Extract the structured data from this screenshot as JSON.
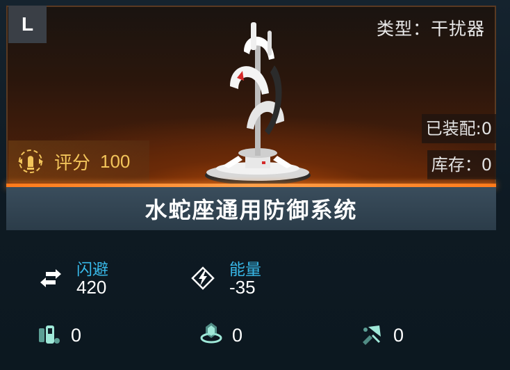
{
  "item": {
    "grade": "L",
    "type_label": "类型：干扰器",
    "equipped_label": "已装配:0",
    "stock_label": "库存：0",
    "score_label": "评分",
    "score_value": "100",
    "name": "水蛇座通用防御系统"
  },
  "stats": [
    {
      "label": "闪避",
      "value": "420",
      "icon": "dodge-arrows-icon"
    },
    {
      "label": "能量",
      "value": "-35",
      "icon": "energy-bolt-icon"
    }
  ],
  "sub_stats": [
    {
      "value": "0",
      "icon": "crew-module-icon"
    },
    {
      "value": "0",
      "icon": "shield-ring-icon"
    },
    {
      "value": "0",
      "icon": "damage-break-icon"
    }
  ],
  "colors": {
    "accent_orange": "#ff7a1a",
    "score_gold": "#f2c45a",
    "stat_label_blue": "#38b8e8",
    "icon_teal": "#7fd8c8"
  }
}
